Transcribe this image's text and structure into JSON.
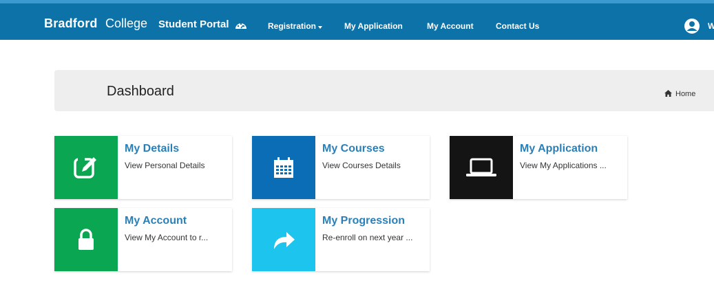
{
  "navbar": {
    "brand_bold": "Bradford",
    "brand_light": "College",
    "brand_portal": "Student Portal",
    "items": [
      {
        "label": "Registration",
        "has_dropdown": true
      },
      {
        "label": "My Application"
      },
      {
        "label": "My Account"
      },
      {
        "label": "Contact Us"
      }
    ],
    "user_initial": "W"
  },
  "header": {
    "title": "Dashboard",
    "breadcrumb_home": "Home"
  },
  "cards": [
    {
      "title": "My Details",
      "subtitle": "View Personal Details",
      "color": "#0aa651",
      "icon": "edit-icon"
    },
    {
      "title": "My Courses",
      "subtitle": "View Courses Details",
      "color": "#0a6db5",
      "icon": "calendar-icon"
    },
    {
      "title": "My Application",
      "subtitle": "View My Applications ...",
      "color": "#141414",
      "icon": "laptop-icon"
    },
    {
      "title": "My Account",
      "subtitle": "View My Account to r...",
      "color": "#0aa651",
      "icon": "lock-icon"
    },
    {
      "title": "My Progression",
      "subtitle": "Re-enroll on next year ...",
      "color": "#1cc4ee",
      "icon": "share-arrow-icon"
    }
  ],
  "colors": {
    "navbar_bg": "#0d72a8",
    "header_bg": "#eeeeee",
    "card_title": "#2980b9"
  }
}
